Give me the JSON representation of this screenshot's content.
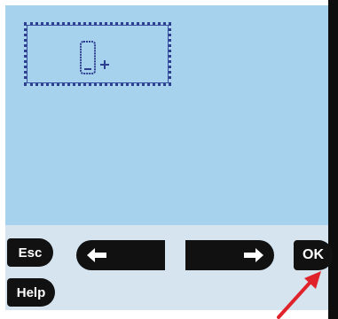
{
  "softkeys": {
    "esc_label": "Esc",
    "help_label": "Help",
    "ok_label": "OK"
  },
  "icons": {
    "tile": "phone-add-icon",
    "left": "arrow-left-icon",
    "right": "arrow-right-icon",
    "annotation": "red-pointer-arrow"
  },
  "colors": {
    "screen": "#a7d2ee",
    "key": "#111111",
    "tile_border": "#2f3f8f",
    "annotation": "#e0222a"
  }
}
